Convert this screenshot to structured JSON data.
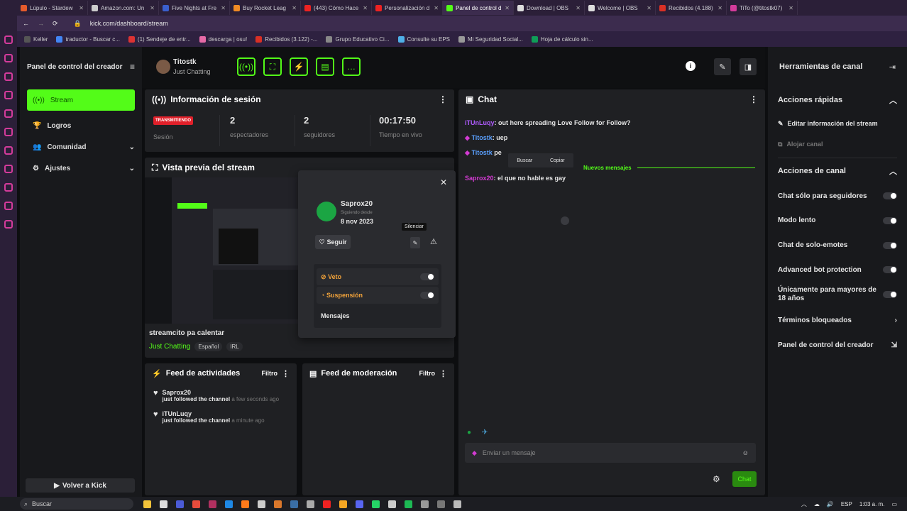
{
  "browser": {
    "tabs": [
      {
        "title": "Lúpulo - Stardew",
        "color": "#e55b2c"
      },
      {
        "title": "Amazon.com: Un",
        "color": "#cccccc"
      },
      {
        "title": "Five Nights at Fre",
        "color": "#3a5fcd"
      },
      {
        "title": "Buy Rocket Leag",
        "color": "#f08a24"
      },
      {
        "title": "(443) Cómo Hace",
        "color": "#e22"
      },
      {
        "title": "Personalización d",
        "color": "#e22"
      },
      {
        "title": "Panel de control d",
        "color": "#53fc18"
      },
      {
        "title": "Download | OBS",
        "color": "#ddd"
      },
      {
        "title": "Welcome | OBS",
        "color": "#ddd"
      },
      {
        "title": "Recibidos (4.188)",
        "color": "#d93025"
      },
      {
        "title": "TiTo (@titostk07)",
        "color": "#d33b9b"
      }
    ],
    "url": "kick.com/dashboard/stream",
    "bookmarks": [
      {
        "label": "Keller",
        "color": "#555"
      },
      {
        "label": "traductor - Buscar c...",
        "color": "#4285f4"
      },
      {
        "label": "(1) Sendeje de entr...",
        "color": "#d33"
      },
      {
        "label": "descarga | osu!",
        "color": "#e66aa7"
      },
      {
        "label": "Recibidos (3.122) -...",
        "color": "#d93025"
      },
      {
        "label": "Grupo Educativo Ci...",
        "color": "#888"
      },
      {
        "label": "Consulte su EPS",
        "color": "#4fb0e8"
      },
      {
        "label": "Mi Seguridad Social...",
        "color": "#999"
      },
      {
        "label": "Hoja de cálculo sin...",
        "color": "#0f9d58"
      }
    ]
  },
  "sidebar": {
    "title": "Panel de control del creador",
    "items": [
      {
        "label": "Stream"
      },
      {
        "label": "Logros"
      },
      {
        "label": "Comunidad"
      },
      {
        "label": "Ajustes"
      }
    ],
    "back_button": "Volver a Kick"
  },
  "header": {
    "channel": "Titostk",
    "category": "Just Chatting"
  },
  "session": {
    "title": "Información de sesión",
    "badge": "TRANSMITIENDO",
    "stats": [
      {
        "value": "",
        "label": "Sesión"
      },
      {
        "value": "2",
        "label": "espectadores"
      },
      {
        "value": "2",
        "label": "seguidores"
      },
      {
        "value": "00:17:50",
        "label": "Tiempo en vivo"
      }
    ]
  },
  "preview": {
    "title": "Vista previa del stream",
    "stream_title": "streamcito pa calentar",
    "category": "Just Chatting",
    "tags": [
      "Español",
      "IRL"
    ]
  },
  "popup": {
    "username": "Saprox20",
    "following_since_label": "Siguiendo desde",
    "following_since": "8 nov 2023",
    "follow_button": "Seguir",
    "tooltip": "Silenciar",
    "veto": "Veto",
    "suspension": "Suspensión",
    "messages": "Mensajes"
  },
  "activity": {
    "title": "Feed de actividades",
    "filter": "Filtro",
    "items": [
      {
        "user": "Saprox20",
        "action": "just followed the channel",
        "time": "a few seconds ago"
      },
      {
        "user": "iTUnLuqy",
        "action": "just followed the channel",
        "time": "a minute ago"
      }
    ]
  },
  "moderation": {
    "title": "Feed de moderación",
    "filter": "Filtro"
  },
  "chat": {
    "title": "Chat",
    "messages": [
      {
        "user": "iTUnLuqy",
        "text": "out here spreading Love Follow for Follow?",
        "color": "#b05cff"
      },
      {
        "user": "Titostk",
        "text": "uep",
        "color": "#5aa0ff"
      },
      {
        "user": "Titostk",
        "text": "pe",
        "color": "#5aa0ff"
      },
      {
        "user": "Saprox20",
        "text": "el que no hable es gay",
        "color": "#d33bd3"
      }
    ],
    "context_menu": [
      "Buscar",
      "Copiar"
    ],
    "new_messages": "Nuevos mensajes",
    "input_placeholder": "Enviar un mensaje",
    "send_button": "Chat"
  },
  "right": {
    "title": "Herramientas de canal",
    "quick_actions": "Acciones rápidas",
    "edit_stream": "Editar información del stream",
    "host_channel": "Alojar canal",
    "channel_actions": "Acciones de canal",
    "toggles": [
      "Chat sólo para seguidores",
      "Modo lento",
      "Chat de solo-emotes",
      "Advanced bot protection",
      "Únicamente para mayores de 18 años"
    ],
    "blocked_terms": "Términos bloqueados",
    "creator_dashboard": "Panel de control del creador"
  },
  "taskbar": {
    "search": "Buscar",
    "lang": "ESP",
    "time": "1:03 a. m."
  }
}
